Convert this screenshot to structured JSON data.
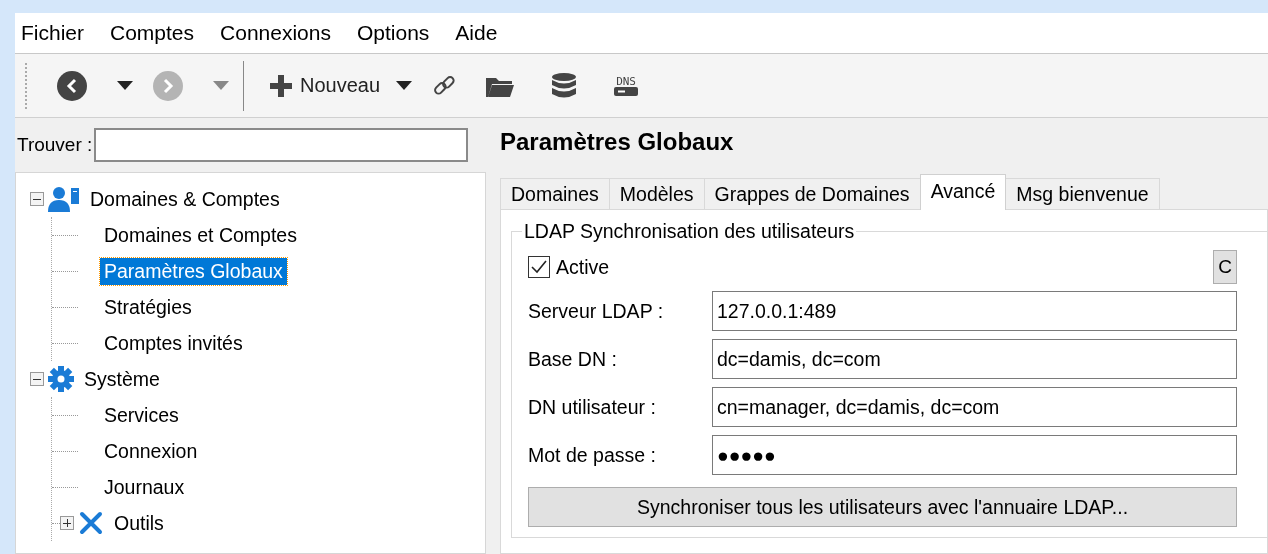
{
  "menu": [
    {
      "label": "Fichier"
    },
    {
      "label": "Comptes"
    },
    {
      "label": "Connexions"
    },
    {
      "label": "Options"
    },
    {
      "label": "Aide"
    }
  ],
  "toolbar": [
    {
      "kind": "back",
      "disabled": false
    },
    {
      "kind": "dropdown",
      "disabled": false
    },
    {
      "kind": "forward",
      "disabled": true
    },
    {
      "kind": "dropdown",
      "disabled": true
    },
    {
      "kind": "separator"
    },
    {
      "kind": "new",
      "label": "Nouveau",
      "disabled": false
    },
    {
      "kind": "dropdown",
      "disabled": false
    },
    {
      "kind": "link",
      "disabled": false
    },
    {
      "kind": "folder",
      "disabled": false
    },
    {
      "kind": "database",
      "disabled": false
    },
    {
      "kind": "dns",
      "label": "DNS",
      "disabled": false
    }
  ],
  "search": {
    "label": "Trouver :"
  },
  "tree": [
    {
      "label": "Domaines & Comptes",
      "kind": "accounts",
      "expanded": true,
      "selected": false,
      "children": [
        {
          "label": "Domaines et Comptes",
          "selected": false
        },
        {
          "label": "Paramètres Globaux",
          "selected": true
        },
        {
          "label": "Stratégies",
          "selected": false
        },
        {
          "label": "Comptes invités",
          "selected": false
        }
      ]
    },
    {
      "label": "Système",
      "kind": "gear",
      "expanded": true,
      "selected": false,
      "children": [
        {
          "label": "Services",
          "selected": false
        },
        {
          "label": "Connexion",
          "selected": false
        },
        {
          "label": "Journaux",
          "selected": false
        },
        {
          "label": "Outils",
          "kind": "tools",
          "expanded": false,
          "selected": false
        }
      ]
    }
  ],
  "panel": {
    "title": "Paramètres Globaux",
    "tabs": [
      {
        "label": "Domaines",
        "selected": false
      },
      {
        "label": "Modèles",
        "selected": false
      },
      {
        "label": "Grappes de Domaines",
        "selected": false
      },
      {
        "label": "Avancé",
        "selected": true
      },
      {
        "label": "Msg bienvenue",
        "selected": false
      }
    ],
    "group": {
      "title": "LDAP Synchronisation des utilisateurs",
      "active": {
        "label": "Active",
        "checked": true
      },
      "side_button": "C",
      "fields": [
        {
          "label": "Serveur LDAP :",
          "value": "127.0.0.1:489"
        },
        {
          "label": "Base DN :",
          "value": "dc=damis, dc=com"
        },
        {
          "label": "DN utilisateur :",
          "value": "cn=manager, dc=damis, dc=com"
        },
        {
          "label": "Mot de passe :",
          "value": "●●●●●"
        }
      ],
      "button": "Synchroniser tous les utilisateurs avec l'annuaire LDAP..."
    }
  }
}
